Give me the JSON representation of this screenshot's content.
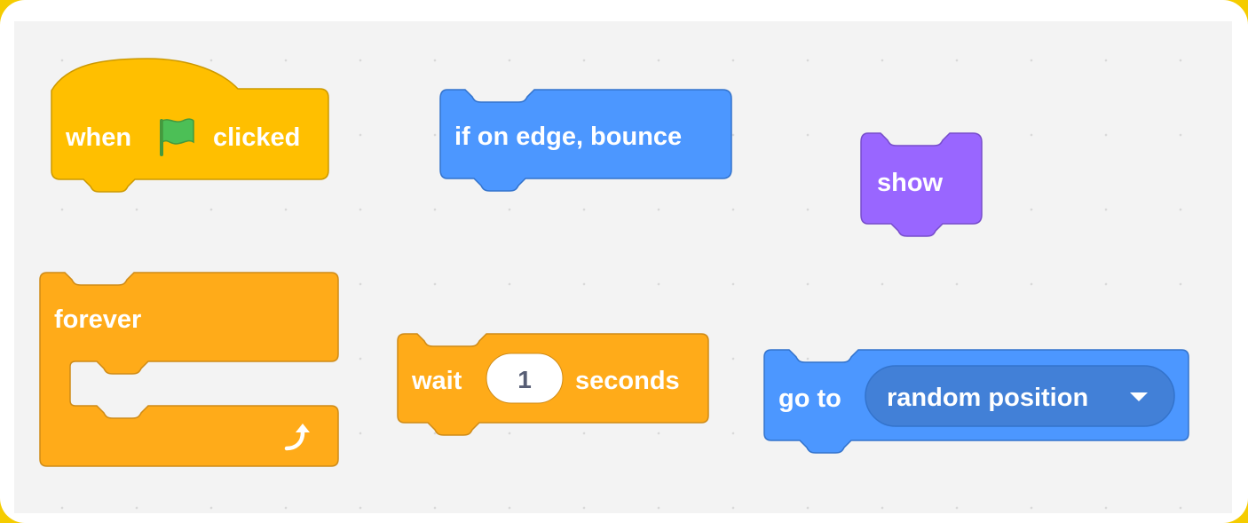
{
  "blocks": {
    "when_flag": {
      "text_before": "when",
      "text_after": "clicked",
      "icon": "green-flag-icon",
      "color": "#ffbf00",
      "stroke": "#cc9900",
      "flag_color": "#4cbf56"
    },
    "bounce": {
      "label": "if on edge, bounce",
      "color": "#4c97ff",
      "stroke": "#3373cc"
    },
    "show": {
      "label": "show",
      "color": "#9966ff",
      "stroke": "#774dcb"
    },
    "forever": {
      "label": "forever",
      "icon": "loop-arrow-icon",
      "color": "#ffab19",
      "stroke": "#cf8b17"
    },
    "wait": {
      "label_before": "wait",
      "value": "1",
      "label_after": "seconds",
      "color": "#ffab19",
      "stroke": "#cf8b17"
    },
    "goto": {
      "label": "go to",
      "dropdown_value": "random position",
      "dropdown_icon": "dropdown-caret-icon",
      "color": "#4c97ff",
      "stroke": "#3373cc",
      "dropdown_color": "#4280d7"
    }
  }
}
